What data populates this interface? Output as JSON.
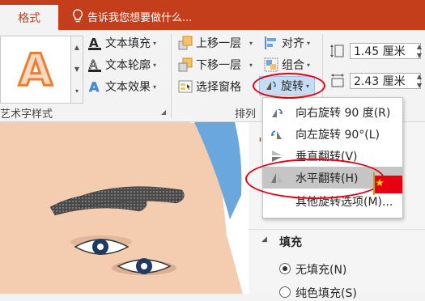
{
  "ribbon_tab": {
    "label": "格式"
  },
  "tell_me": {
    "text": "告诉我您想要做什么..."
  },
  "wordart_styles": {
    "preview_letter": "A",
    "text_fill": "文本填充",
    "text_outline": "文本轮廓",
    "text_effects": "文本效果",
    "group_label": "艺术字样式"
  },
  "arrange": {
    "bring_forward": "上移一层",
    "send_backward": "下移一层",
    "selection_pane": "选择窗格",
    "align": "对齐",
    "group": "组合",
    "rotate": "旋转",
    "group_label": "排列"
  },
  "size": {
    "height_value": "1.45 厘米",
    "width_value": "2.43 厘米"
  },
  "rotate_menu": {
    "items": [
      {
        "label": "向右旋转 90 度(R)"
      },
      {
        "label": "向左旋转 90°(L)"
      },
      {
        "label": "垂直翻转(V)"
      },
      {
        "label": "水平翻转(H)"
      },
      {
        "label": "其他旋转选项(M)..."
      }
    ]
  },
  "format_pane": {
    "fill_section": "填充",
    "no_fill": "无填充(N)",
    "solid_fill": "纯色填充(S)"
  },
  "colors": {
    "accent": "#c43e1c",
    "annotation": "#e60012",
    "skin": "#f4cdb0"
  }
}
